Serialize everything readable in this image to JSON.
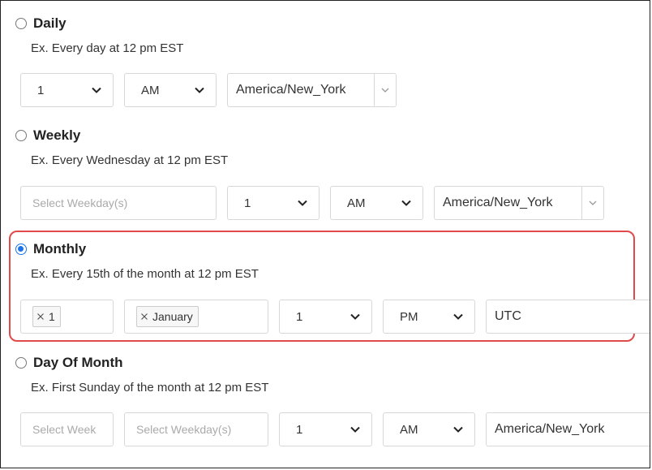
{
  "colors": {
    "accent": "#1a73e8",
    "highlight": "#e04a4a"
  },
  "daily": {
    "label": "Daily",
    "example": "Ex. Every day at 12 pm EST",
    "hour": "1",
    "ampm": "AM",
    "timezone": "America/New_York"
  },
  "weekly": {
    "label": "Weekly",
    "example": "Ex. Every Wednesday at 12 pm EST",
    "weekday_placeholder": "Select Weekday(s)",
    "hour": "1",
    "ampm": "AM",
    "timezone": "America/New_York"
  },
  "monthly": {
    "label": "Monthly",
    "example": "Ex. Every 15th of the month at 12 pm EST",
    "day_tag": "1",
    "month_tag": "January",
    "hour": "1",
    "ampm": "PM",
    "timezone": "UTC",
    "selected": true
  },
  "day_of_month": {
    "label": "Day Of Month",
    "example": "Ex. First Sunday of the month at 12 pm EST",
    "week_placeholder": "Select Week",
    "weekday_placeholder": "Select Weekday(s)",
    "hour": "1",
    "ampm": "AM",
    "timezone": "America/New_York"
  }
}
